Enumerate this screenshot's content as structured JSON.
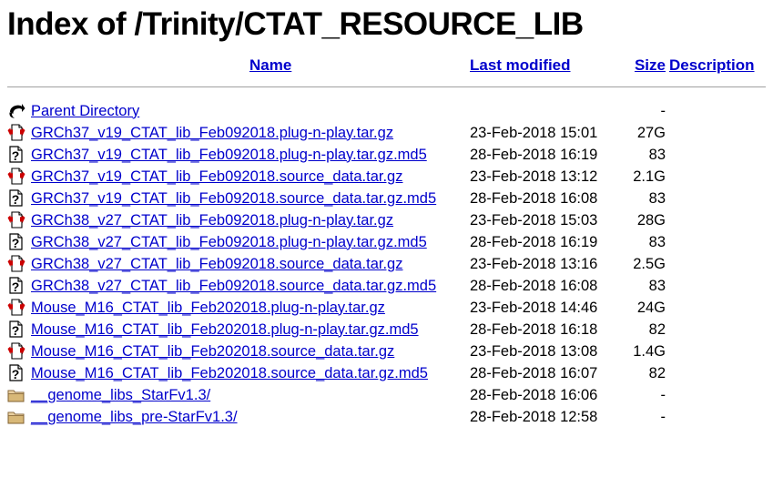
{
  "page": {
    "title": "Index of /Trinity/CTAT_RESOURCE_LIB"
  },
  "table": {
    "headers": {
      "name": "Name",
      "last_modified": "Last modified",
      "size": "Size",
      "description": "Description"
    },
    "rows": [
      {
        "icon": "parent-directory-icon",
        "name": "Parent Directory",
        "last_modified": "",
        "size": "-",
        "description": ""
      },
      {
        "icon": "compressed-file-icon",
        "name": "GRCh37_v19_CTAT_lib_Feb092018.plug-n-play.tar.gz",
        "last_modified": "23-Feb-2018 15:01",
        "size": "27G",
        "description": ""
      },
      {
        "icon": "unknown-file-icon",
        "name": "GRCh37_v19_CTAT_lib_Feb092018.plug-n-play.tar.gz.md5",
        "last_modified": "28-Feb-2018 16:19",
        "size": "83",
        "description": ""
      },
      {
        "icon": "compressed-file-icon",
        "name": "GRCh37_v19_CTAT_lib_Feb092018.source_data.tar.gz",
        "last_modified": "23-Feb-2018 13:12",
        "size": "2.1G",
        "description": ""
      },
      {
        "icon": "unknown-file-icon",
        "name": "GRCh37_v19_CTAT_lib_Feb092018.source_data.tar.gz.md5",
        "last_modified": "28-Feb-2018 16:08",
        "size": "83",
        "description": ""
      },
      {
        "icon": "compressed-file-icon",
        "name": "GRCh38_v27_CTAT_lib_Feb092018.plug-n-play.tar.gz",
        "last_modified": "23-Feb-2018 15:03",
        "size": "28G",
        "description": ""
      },
      {
        "icon": "unknown-file-icon",
        "name": "GRCh38_v27_CTAT_lib_Feb092018.plug-n-play.tar.gz.md5",
        "last_modified": "28-Feb-2018 16:19",
        "size": "83",
        "description": ""
      },
      {
        "icon": "compressed-file-icon",
        "name": "GRCh38_v27_CTAT_lib_Feb092018.source_data.tar.gz",
        "last_modified": "23-Feb-2018 13:16",
        "size": "2.5G",
        "description": ""
      },
      {
        "icon": "unknown-file-icon",
        "name": "GRCh38_v27_CTAT_lib_Feb092018.source_data.tar.gz.md5",
        "last_modified": "28-Feb-2018 16:08",
        "size": "83",
        "description": ""
      },
      {
        "icon": "compressed-file-icon",
        "name": "Mouse_M16_CTAT_lib_Feb202018.plug-n-play.tar.gz",
        "last_modified": "23-Feb-2018 14:46",
        "size": "24G",
        "description": ""
      },
      {
        "icon": "unknown-file-icon",
        "name": "Mouse_M16_CTAT_lib_Feb202018.plug-n-play.tar.gz.md5",
        "last_modified": "28-Feb-2018 16:18",
        "size": "82",
        "description": ""
      },
      {
        "icon": "compressed-file-icon",
        "name": "Mouse_M16_CTAT_lib_Feb202018.source_data.tar.gz",
        "last_modified": "23-Feb-2018 13:08",
        "size": "1.4G",
        "description": ""
      },
      {
        "icon": "unknown-file-icon",
        "name": "Mouse_M16_CTAT_lib_Feb202018.source_data.tar.gz.md5",
        "last_modified": "28-Feb-2018 16:07",
        "size": "82",
        "description": ""
      },
      {
        "icon": "folder-icon",
        "name": "__genome_libs_StarFv1.3/",
        "last_modified": "28-Feb-2018 16:06",
        "size": "-",
        "description": ""
      },
      {
        "icon": "folder-icon",
        "name": "__genome_libs_pre-StarFv1.3/",
        "last_modified": "28-Feb-2018 12:58",
        "size": "-",
        "description": ""
      }
    ]
  },
  "colors": {
    "link": "#0000cc",
    "text": "#000000",
    "rule": "#a0a0a0",
    "folder": "#d8b878",
    "arrow_red": "#cc0000"
  }
}
